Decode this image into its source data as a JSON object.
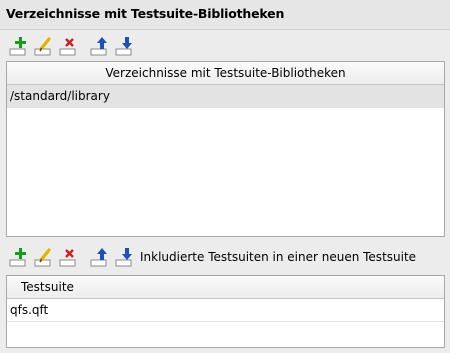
{
  "header": {
    "title": "Verzeichnisse mit Testsuite-Bibliotheken"
  },
  "toolbar_top": {
    "buttons": [
      "add-icon",
      "edit-icon",
      "delete-icon",
      "move-up-icon",
      "move-down-icon"
    ]
  },
  "table_top": {
    "column_header": "Verzeichnisse mit Testsuite-Bibliotheken",
    "rows": [
      "/standard/library"
    ]
  },
  "toolbar_bottom": {
    "label": "Inkludierte Testsuiten in einer neuen Testsuite"
  },
  "table_bottom": {
    "column_header": "Testsuite",
    "rows": [
      "qfs.qft"
    ]
  },
  "colors": {
    "add": "#1a9b1a",
    "edit": "#e3b400",
    "delete": "#c8201e",
    "arrow": "#1f4fb8"
  }
}
